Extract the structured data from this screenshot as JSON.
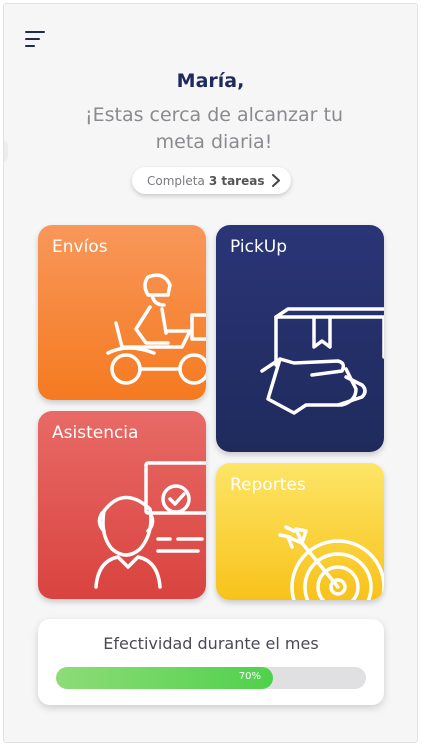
{
  "header": {
    "menu_icon": "menu-icon"
  },
  "greeting": {
    "name": "María,",
    "message": "¡Estas cerca de alcanzar tu meta diaria!"
  },
  "goal_pill": {
    "prefix": "Completa",
    "count_text": "3 tareas",
    "icon": "chevron-right-icon"
  },
  "cards": {
    "envios": {
      "label": "Envíos",
      "icon": "delivery-scooter-icon",
      "color": "#f57a20"
    },
    "pickup": {
      "label": "PickUp",
      "icon": "package-hand-icon",
      "color": "#1f2a5c"
    },
    "asistencia": {
      "label": "Asistencia",
      "icon": "support-agent-icon",
      "color": "#d9433f"
    },
    "reportes": {
      "label": "Reportes",
      "icon": "target-arrow-icon",
      "color": "#f8c21a"
    }
  },
  "effectiveness": {
    "title": "Efectividad durante el mes",
    "percent": 70,
    "percent_label": "70%"
  }
}
